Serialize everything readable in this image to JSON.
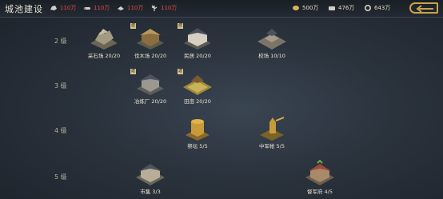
{
  "header": {
    "title": "城池建设",
    "costs": [
      {
        "icon": "stone-icon",
        "value": "110万"
      },
      {
        "icon": "wood-icon",
        "value": "110万"
      },
      {
        "icon": "iron-icon",
        "value": "110万"
      },
      {
        "icon": "grain-icon",
        "value": "110万"
      }
    ],
    "resources": [
      {
        "icon": "copper-coin-icon",
        "value": "500万"
      },
      {
        "icon": "silver-icon",
        "value": "476万"
      },
      {
        "icon": "jade-icon",
        "value": "643万"
      }
    ]
  },
  "levels": [
    "2 级",
    "3 级",
    "4 级",
    "5 级"
  ],
  "buildings": [
    {
      "label": "采石场 20/20",
      "badge": "建"
    },
    {
      "label": "伐木场 20/20",
      "badge": "建"
    },
    {
      "label": "民居 20/20",
      "badge": "建"
    },
    {
      "label": "校场 10/10",
      "badge": ""
    },
    {
      "label": "冶炼厂 20/20",
      "badge": "建"
    },
    {
      "label": "田亩 20/20",
      "badge": "建"
    },
    {
      "label": "祭坛 5/5",
      "badge": ""
    },
    {
      "label": "中军帐 5/5",
      "badge": ""
    },
    {
      "label": "市集 3/3",
      "badge": ""
    },
    {
      "label": "督军府 4/5",
      "badge": ""
    }
  ],
  "colors": {
    "cost_red": "#e04a3a",
    "gold": "#c9a24a"
  }
}
